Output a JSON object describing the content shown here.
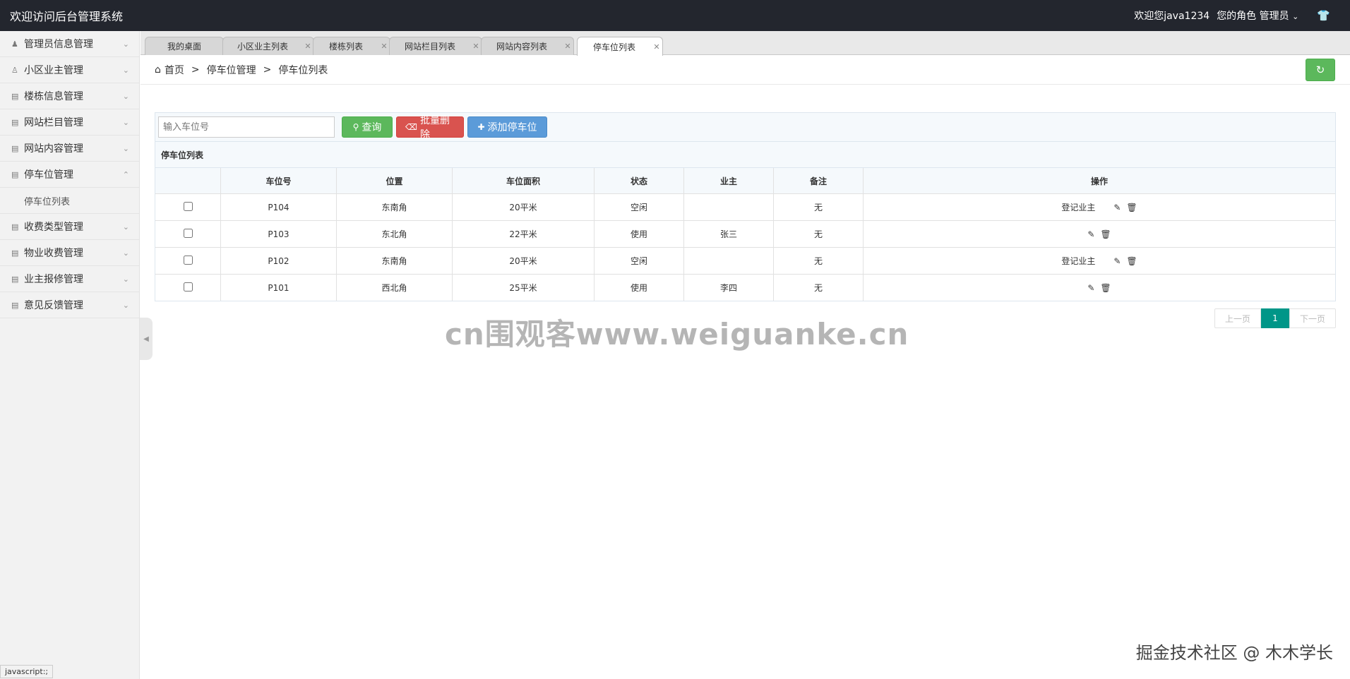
{
  "app": {
    "title": "欢迎访问后台管理系统",
    "welcome": "欢迎您java1234",
    "role": "您的角色 管理员"
  },
  "sidebar": {
    "items": [
      {
        "label": "管理员信息管理",
        "icon": "user-icon"
      },
      {
        "label": "小区业主管理",
        "icon": "user-outline-icon"
      },
      {
        "label": "楼栋信息管理",
        "icon": "list-icon"
      },
      {
        "label": "网站栏目管理",
        "icon": "list-icon"
      },
      {
        "label": "网站内容管理",
        "icon": "list-icon"
      },
      {
        "label": "停车位管理",
        "icon": "list-icon",
        "expanded": true
      },
      {
        "label": "收费类型管理",
        "icon": "list-icon"
      },
      {
        "label": "物业收费管理",
        "icon": "list-icon"
      },
      {
        "label": "业主报修管理",
        "icon": "list-icon"
      },
      {
        "label": "意见反馈管理",
        "icon": "list-icon"
      }
    ],
    "sub_item": "停车位列表"
  },
  "tabs": [
    {
      "label": "我的桌面",
      "closable": false
    },
    {
      "label": "小区业主列表",
      "closable": true
    },
    {
      "label": "楼栋列表",
      "closable": true
    },
    {
      "label": "网站栏目列表",
      "closable": true
    },
    {
      "label": "网站内容列表",
      "closable": true
    },
    {
      "label": "停车位列表",
      "closable": true,
      "active": true
    }
  ],
  "breadcrumb": {
    "home": "首页",
    "sep": ">",
    "level1": "停车位管理",
    "level2": "停车位列表"
  },
  "toolbar": {
    "search_placeholder": "输入车位号",
    "search_label": "查询",
    "batch_delete_label": "批量删除",
    "add_label": "添加停车位"
  },
  "table": {
    "title": "停车位列表",
    "headers": [
      "",
      "车位号",
      "位置",
      "车位面积",
      "状态",
      "业主",
      "备注",
      "操作"
    ],
    "rows": [
      {
        "no": "P104",
        "location": "东南角",
        "area": "20平米",
        "status": "空闲",
        "owner": "",
        "remark": "无",
        "action": "登记业主"
      },
      {
        "no": "P103",
        "location": "东北角",
        "area": "22平米",
        "status": "使用",
        "owner": "张三",
        "remark": "无",
        "action": ""
      },
      {
        "no": "P102",
        "location": "东南角",
        "area": "20平米",
        "status": "空闲",
        "owner": "",
        "remark": "无",
        "action": "登记业主"
      },
      {
        "no": "P101",
        "location": "西北角",
        "area": "25平米",
        "status": "使用",
        "owner": "李四",
        "remark": "无",
        "action": ""
      }
    ]
  },
  "pager": {
    "prev": "上一页",
    "current": "1",
    "next": "下一页"
  },
  "status_bar": "javascript:;",
  "watermark": "cn围观客www.weiguanke.cn",
  "credit": "掘金技术社区 @ 木木学长",
  "colors": {
    "topbar": "#23262e",
    "search_button": "#5cb85c",
    "delete_button": "#d9534f",
    "add_button": "#5b9bd9",
    "pager_active": "#009688"
  }
}
